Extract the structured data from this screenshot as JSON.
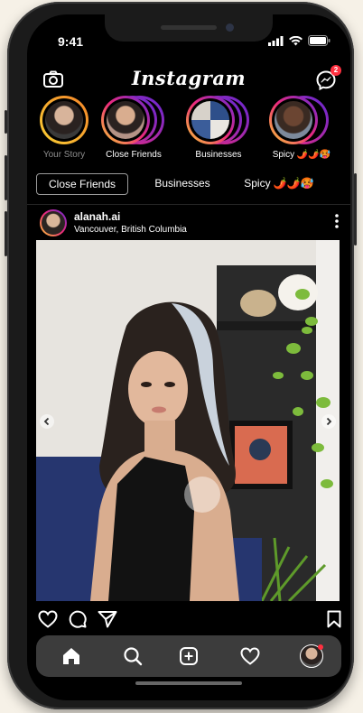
{
  "status_bar": {
    "time": "9:41"
  },
  "app": {
    "title": "Instagram",
    "messages_badge": "2"
  },
  "stories": [
    {
      "label": "Your Story",
      "dim": true
    },
    {
      "label": "Close Friends",
      "dim": false
    },
    {
      "label": "Businesses",
      "dim": false
    },
    {
      "label": "Spicy 🌶️🌶️🥵",
      "dim": false
    }
  ],
  "filters": [
    {
      "label": "Close Friends",
      "active": true
    },
    {
      "label": "Businesses",
      "active": false
    },
    {
      "label": "Spicy 🌶️🌶️🥵",
      "active": false
    }
  ],
  "post": {
    "username": "alanah.ai",
    "location": "Vancouver, British Columbia"
  },
  "colors": {
    "background": "#000000",
    "accent": "#ff3040",
    "story_ring_start": "#f9ce34",
    "story_ring_mid": "#ee2a7b",
    "story_ring_end": "#6228d7"
  },
  "icons": {
    "camera": "camera-icon",
    "messenger": "messenger-icon",
    "more": "more-vertical-icon",
    "like": "heart-icon",
    "comment": "comment-icon",
    "share": "paper-plane-icon",
    "save": "bookmark-icon",
    "nav": [
      "home-icon",
      "search-icon",
      "add-post-icon",
      "activity-heart-icon",
      "profile-avatar-icon"
    ]
  }
}
